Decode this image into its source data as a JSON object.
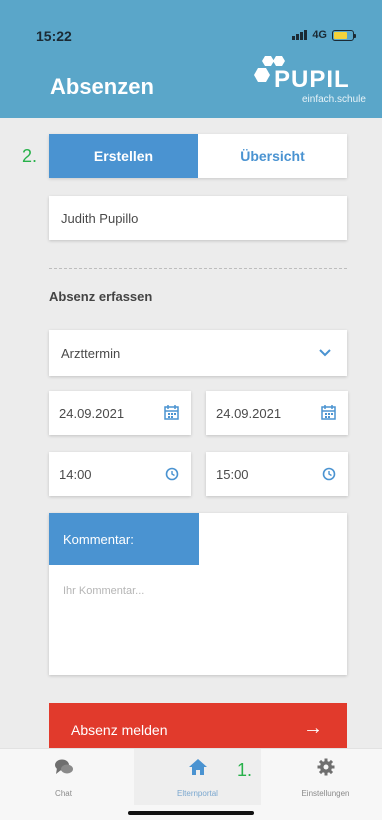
{
  "status_bar": {
    "time": "15:22",
    "network": "4G"
  },
  "header": {
    "title": "Absenzen",
    "logo_text": "PUPIL",
    "logo_subtitle": "einfach.schule"
  },
  "annotations": {
    "step_2": "2.",
    "step_1": "1."
  },
  "tabs": [
    {
      "label": "Erstellen",
      "active": true
    },
    {
      "label": "Übersicht",
      "active": false
    }
  ],
  "form": {
    "student_name": "Judith Pupillo",
    "section_title": "Absenz erfassen",
    "reason": "Arzttermin",
    "date_from": "24.09.2021",
    "date_to": "24.09.2021",
    "time_from": "14:00",
    "time_to": "15:00",
    "comment_label": "Kommentar:",
    "comment_placeholder": "Ihr Kommentar...",
    "submit_label": "Absenz melden"
  },
  "bottom_nav": [
    {
      "label": "Chat",
      "icon": "chat-icon"
    },
    {
      "label": "Elternportal",
      "icon": "home-icon",
      "active": true
    },
    {
      "label": "Einstellungen",
      "icon": "gear-icon"
    }
  ],
  "colors": {
    "header": "#5aa6c9",
    "accent": "#4a93d1",
    "submit": "#e13a2c",
    "annotation": "#27b14a"
  }
}
